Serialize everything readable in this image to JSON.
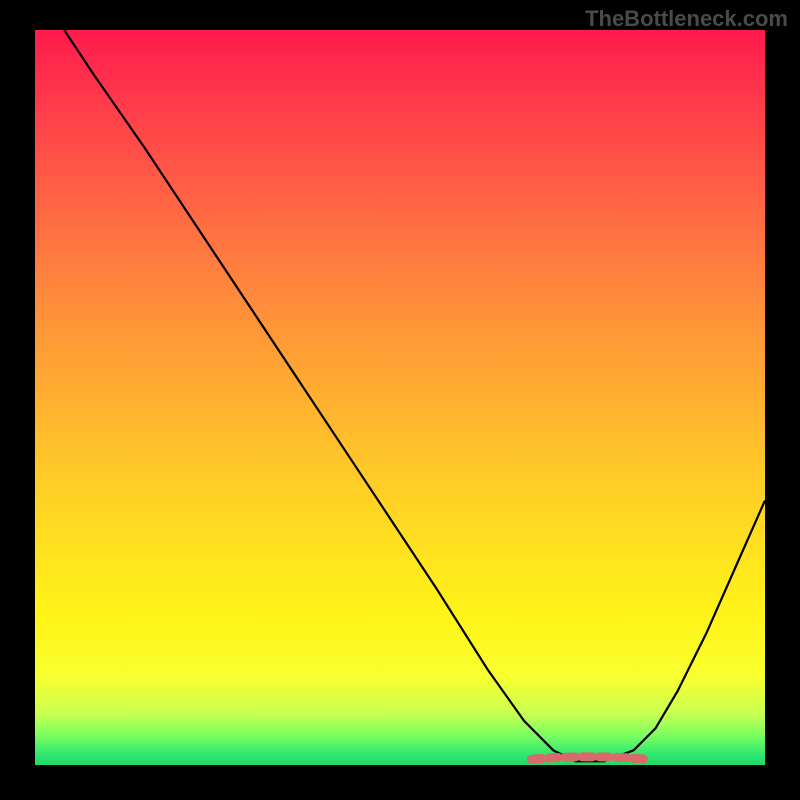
{
  "watermark": "TheBottleneck.com",
  "chart_data": {
    "type": "line",
    "title": "",
    "xlabel": "",
    "ylabel": "",
    "xlim": [
      0,
      100
    ],
    "ylim": [
      0,
      100
    ],
    "grid": false,
    "series": [
      {
        "name": "bottleneck-curve",
        "color": "#000000",
        "x": [
          4,
          8,
          15,
          25,
          35,
          45,
          55,
          62,
          67,
          71,
          74,
          78,
          82,
          85,
          88,
          92,
          96,
          100
        ],
        "y": [
          100,
          94,
          84,
          69,
          54,
          39,
          24,
          13,
          6,
          2,
          0.5,
          0.5,
          2,
          5,
          10,
          18,
          27,
          36
        ]
      }
    ],
    "highlight": {
      "name": "optimal-zone",
      "color": "#d86a6a",
      "x_range": [
        68,
        84
      ],
      "y": 0.5
    },
    "gradient_mapping": {
      "description": "vertical gradient red (top, high bottleneck) to green (bottom, low bottleneck)",
      "stops": [
        {
          "pos": 0,
          "color": "#ff1a4d"
        },
        {
          "pos": 50,
          "color": "#ffaf30"
        },
        {
          "pos": 88,
          "color": "#f8ff30"
        },
        {
          "pos": 100,
          "color": "#20d868"
        }
      ]
    }
  }
}
